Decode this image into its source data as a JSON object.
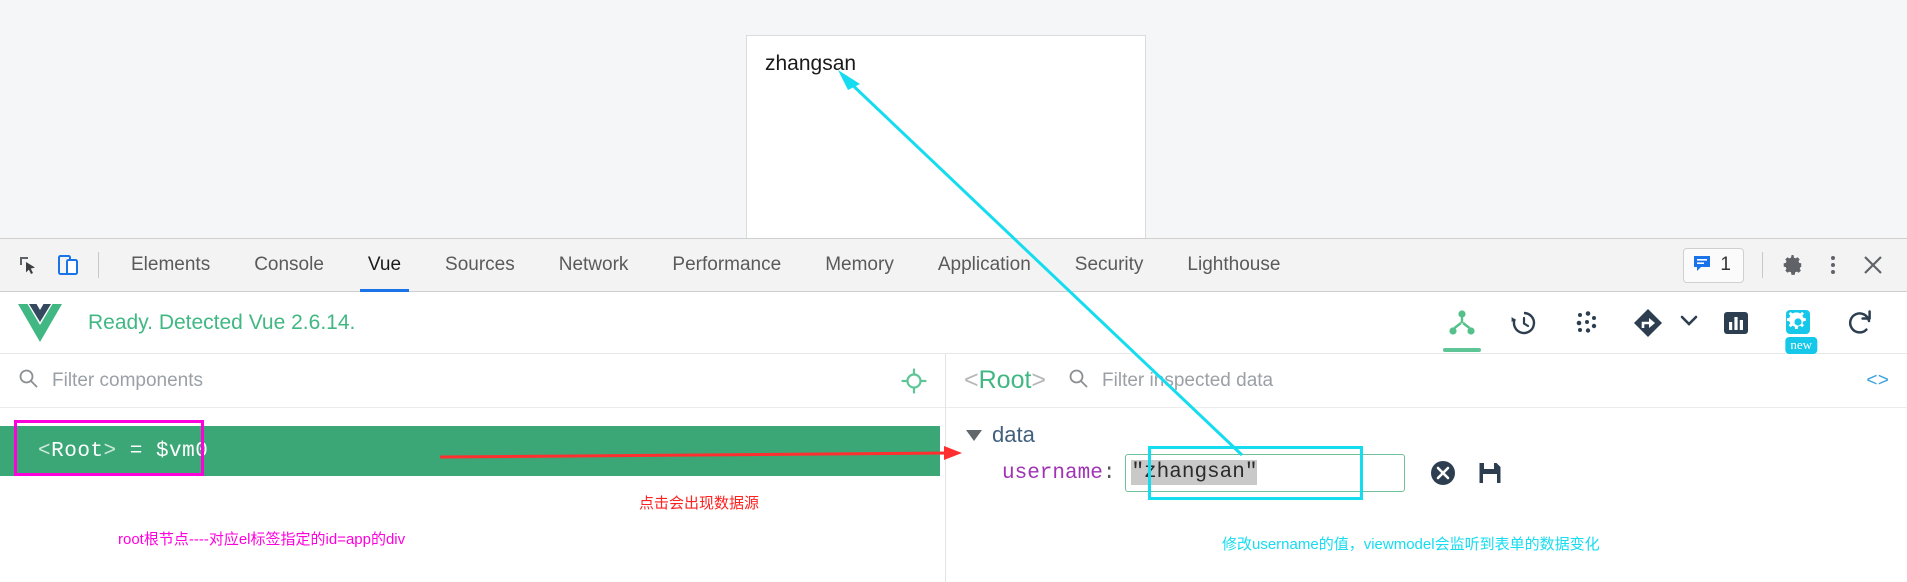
{
  "page": {
    "input_value": "zhangsan"
  },
  "devtools": {
    "tabs": [
      {
        "label": "Elements",
        "active": false
      },
      {
        "label": "Console",
        "active": false
      },
      {
        "label": "Vue",
        "active": true
      },
      {
        "label": "Sources",
        "active": false
      },
      {
        "label": "Network",
        "active": false
      },
      {
        "label": "Performance",
        "active": false
      },
      {
        "label": "Memory",
        "active": false
      },
      {
        "label": "Application",
        "active": false
      },
      {
        "label": "Security",
        "active": false
      },
      {
        "label": "Lighthouse",
        "active": false
      }
    ],
    "message_count": "1",
    "icons": {
      "inspect": "inspect-element-icon",
      "device": "device-toolbar-icon",
      "messages": "message-icon",
      "settings": "gear-icon",
      "more": "kebab-menu-icon",
      "close": "close-icon"
    }
  },
  "vue_panel": {
    "status": "Ready. Detected Vue 2.6.14.",
    "logo": "vue-logo-icon",
    "toolbar": [
      {
        "name": "components-tree-icon",
        "active": true
      },
      {
        "name": "timeline-history-icon",
        "active": false
      },
      {
        "name": "vuex-dots-icon",
        "active": false
      },
      {
        "name": "routing-diamond-icon",
        "active": false
      },
      {
        "name": "performance-bars-icon",
        "active": false
      },
      {
        "name": "settings-gear-icon",
        "active": false,
        "badge": "new"
      },
      {
        "name": "refresh-icon",
        "active": false
      }
    ]
  },
  "components_pane": {
    "filter_placeholder": "Filter components",
    "filter_value": "",
    "search_icon": "search-icon",
    "target_icon": "target-crosshair-icon",
    "selected_component": {
      "open_angle": "<",
      "name": "Root",
      "close_angle": ">",
      "assignment": " = $vm0"
    }
  },
  "inspector_pane": {
    "title_open": "<",
    "title_name": "Root",
    "title_close": ">",
    "filter_placeholder": "Filter inspected data",
    "filter_value": "",
    "search_icon": "search-icon",
    "code_toggle": "<>",
    "data_group_label": "data",
    "fields": [
      {
        "key": "username",
        "colon": ":",
        "value": "\"zhangsan\"",
        "editing": true,
        "cancel_icon": "cancel-circle-icon",
        "save_icon": "save-floppy-icon"
      }
    ]
  },
  "annotations": {
    "root_note": "root根节点----对应el标签指定的id=app的div",
    "click_note": "点击会出现数据源",
    "edit_note": "修改username的值，viewmodel会监听到表单的数据变化"
  },
  "colors": {
    "vue_green": "#41b883",
    "row_green": "#3ba776",
    "tab_blue": "#1a73e8",
    "magenta": "#ff00dd",
    "red": "#ff2020",
    "cyan": "#16dcf0",
    "badge_cyan": "#15c7e8"
  }
}
